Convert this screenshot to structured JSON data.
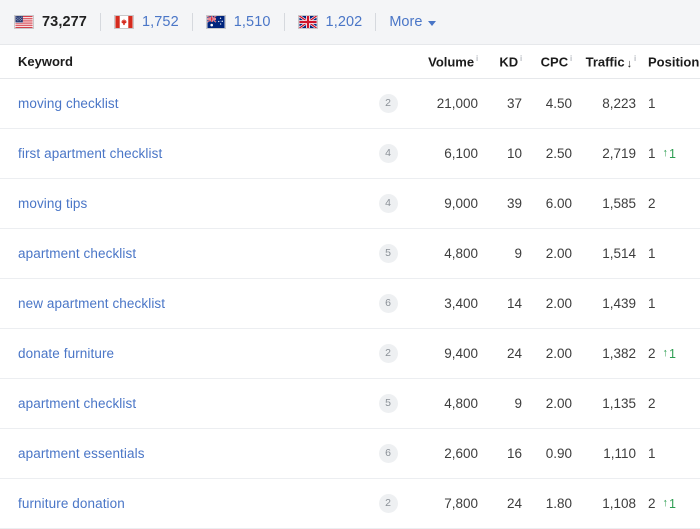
{
  "country_bar": {
    "items": [
      {
        "flag": "us-flag-icon",
        "country": "United States",
        "count": "73,277",
        "active": true
      },
      {
        "flag": "ca-flag-icon",
        "country": "Canada",
        "count": "1,752",
        "active": false
      },
      {
        "flag": "au-flag-icon",
        "country": "Australia",
        "count": "1,510",
        "active": false
      },
      {
        "flag": "gb-flag-icon",
        "country": "United Kingdom",
        "count": "1,202",
        "active": false
      }
    ],
    "more_label": "More",
    "link_color": "#4a76c7",
    "background": "#f4f5f7"
  },
  "table": {
    "columns": [
      {
        "key": "keyword",
        "label": "Keyword",
        "info": false,
        "sorted": false
      },
      {
        "key": "volume",
        "label": "Volume",
        "info": true,
        "sorted": false
      },
      {
        "key": "kd",
        "label": "KD",
        "info": true,
        "sorted": false
      },
      {
        "key": "cpc",
        "label": "CPC",
        "info": true,
        "sorted": false
      },
      {
        "key": "traffic",
        "label": "Traffic",
        "info": true,
        "sorted": true,
        "sort_dir": "↓"
      },
      {
        "key": "position",
        "label": "Position",
        "info": true,
        "sorted": false
      }
    ],
    "info_glyph": "i",
    "rows": [
      {
        "keyword": "moving checklist",
        "badge": "2",
        "volume": "21,000",
        "kd": "37",
        "cpc": "4.50",
        "traffic": "8,223",
        "position": "1",
        "change": "",
        "change_dir": ""
      },
      {
        "keyword": "first apartment checklist",
        "badge": "4",
        "volume": "6,100",
        "kd": "10",
        "cpc": "2.50",
        "traffic": "2,719",
        "position": "1",
        "change": "1",
        "change_dir": "↑"
      },
      {
        "keyword": "moving tips",
        "badge": "4",
        "volume": "9,000",
        "kd": "39",
        "cpc": "6.00",
        "traffic": "1,585",
        "position": "2",
        "change": "",
        "change_dir": ""
      },
      {
        "keyword": "apartment checklist",
        "badge": "5",
        "volume": "4,800",
        "kd": "9",
        "cpc": "2.00",
        "traffic": "1,514",
        "position": "1",
        "change": "",
        "change_dir": ""
      },
      {
        "keyword": "new apartment checklist",
        "badge": "6",
        "volume": "3,400",
        "kd": "14",
        "cpc": "2.00",
        "traffic": "1,439",
        "position": "1",
        "change": "",
        "change_dir": ""
      },
      {
        "keyword": "donate furniture",
        "badge": "2",
        "volume": "9,400",
        "kd": "24",
        "cpc": "2.00",
        "traffic": "1,382",
        "position": "2",
        "change": "1",
        "change_dir": "↑"
      },
      {
        "keyword": "apartment checklist",
        "badge": "5",
        "volume": "4,800",
        "kd": "9",
        "cpc": "2.00",
        "traffic": "1,135",
        "position": "2",
        "change": "",
        "change_dir": ""
      },
      {
        "keyword": "apartment essentials",
        "badge": "6",
        "volume": "2,600",
        "kd": "16",
        "cpc": "0.90",
        "traffic": "1,110",
        "position": "1",
        "change": "",
        "change_dir": ""
      },
      {
        "keyword": "furniture donation",
        "badge": "2",
        "volume": "7,800",
        "kd": "24",
        "cpc": "1.80",
        "traffic": "1,108",
        "position": "2",
        "change": "1",
        "change_dir": "↑"
      }
    ],
    "positive_change_color": "#2e9e52"
  }
}
